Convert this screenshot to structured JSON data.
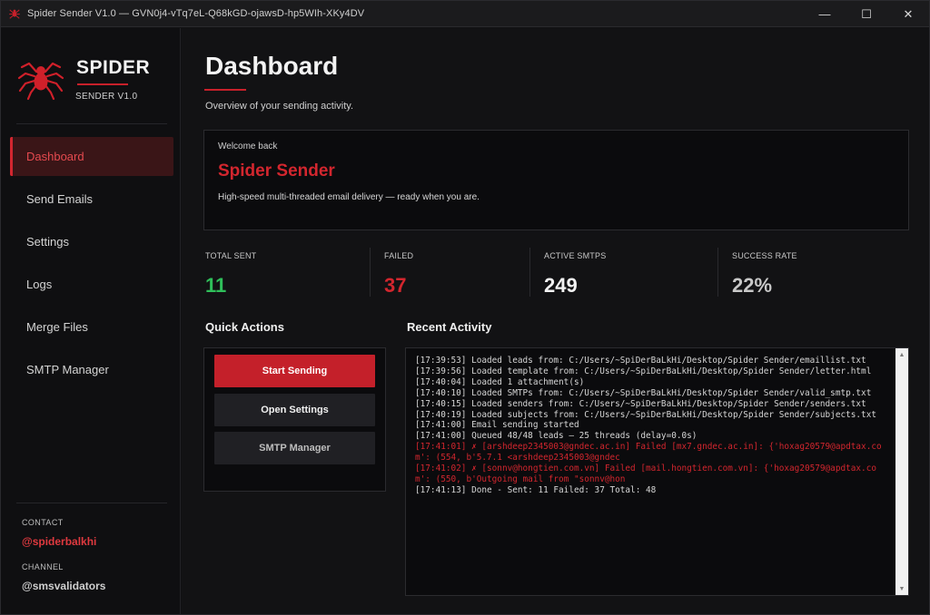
{
  "window": {
    "title": "Spider Sender V1.0 — GVN0j4-vTq7eL-Q68kGD-ojawsD-hp5WIh-XKy4DV",
    "controls": {
      "minimize": "—",
      "maximize": "☐",
      "close": "✕"
    }
  },
  "sidebar": {
    "brand": "SPIDER",
    "version": "SENDER  V1.0",
    "items": [
      {
        "label": "Dashboard",
        "active": true
      },
      {
        "label": "Send Emails"
      },
      {
        "label": "Settings"
      },
      {
        "label": "Logs"
      },
      {
        "label": "Merge Files"
      },
      {
        "label": "SMTP Manager"
      }
    ],
    "contact_label": "CONTACT",
    "contact_value": "@spiderbalkhi",
    "channel_label": "CHANNEL",
    "channel_value": "@smsvalidators"
  },
  "main": {
    "title": "Dashboard",
    "subtitle": "Overview of your sending activity.",
    "welcome": {
      "greeting": "Welcome back",
      "name": "Spider Sender",
      "description": "High-speed multi-threaded email delivery — ready when you are."
    },
    "stats": [
      {
        "label": "TOTAL SENT",
        "value": "11",
        "color": "#2fbf5a"
      },
      {
        "label": "FAILED",
        "value": "37",
        "color": "#d3262e"
      },
      {
        "label": "ACTIVE SMTPS",
        "value": "249",
        "color": "#f2f2f2"
      },
      {
        "label": "SUCCESS RATE",
        "value": "22%",
        "color": "#c8c8c8"
      }
    ],
    "quick_actions": {
      "title": "Quick Actions",
      "start": "Start Sending",
      "settings": "Open Settings",
      "smtp": "SMTP Manager"
    },
    "recent_activity": {
      "title": "Recent Activity",
      "lines": [
        {
          "text": "[17:39:53] Loaded leads from: C:/Users/~SpiDerBaLkHi/Desktop/Spider Sender/emaillist.txt"
        },
        {
          "text": "[17:39:56] Loaded template from: C:/Users/~SpiDerBaLkHi/Desktop/Spider Sender/letter.html"
        },
        {
          "text": "[17:40:04] Loaded 1 attachment(s)"
        },
        {
          "text": "[17:40:10] Loaded SMTPs from: C:/Users/~SpiDerBaLkHi/Desktop/Spider Sender/valid_smtp.txt"
        },
        {
          "text": "[17:40:15] Loaded senders from: C:/Users/~SpiDerBaLkHi/Desktop/Spider Sender/senders.txt"
        },
        {
          "text": "[17:40:19] Loaded subjects from: C:/Users/~SpiDerBaLkHi/Desktop/Spider Sender/subjects.txt"
        },
        {
          "text": "[17:41:00] Email sending started"
        },
        {
          "text": "[17:41:00] Queued 48/48 leads — 25 threads (delay=0.0s)"
        },
        {
          "text": "[17:41:01] ✗ [arshdeep2345003@gndec.ac.in] Failed [mx7.gndec.ac.in]: {'hoxag20579@apdtax.com': (554, b'5.7.1 <arshdeep2345003@gndec",
          "error": true
        },
        {
          "text": "[17:41:02] ✗ [sonnv@hongtien.com.vn] Failed [mail.hongtien.com.vn]: {'hoxag20579@apdtax.com': (550, b'Outgoing mail from \"sonnv@hon",
          "error": true
        },
        {
          "text": "[17:41:13] Done - Sent: 11 Failed: 37 Total: 48"
        }
      ]
    }
  },
  "colors": {
    "accent": "#c8202a",
    "success": "#2fbf5a",
    "danger": "#d3262e"
  }
}
